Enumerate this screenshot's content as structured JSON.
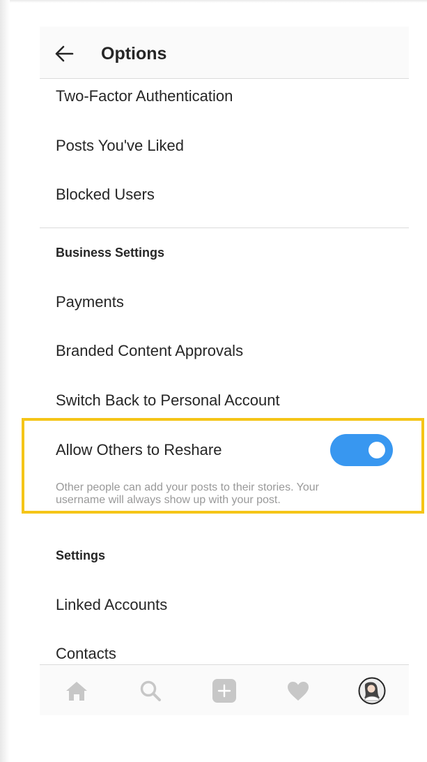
{
  "header": {
    "title": "Options",
    "back_icon": "arrow-left-icon"
  },
  "account_items": [
    {
      "label": "Two-Factor Authentication"
    },
    {
      "label": "Posts You've Liked"
    },
    {
      "label": "Blocked Users"
    }
  ],
  "business": {
    "section_title": "Business Settings",
    "items": [
      {
        "label": "Payments"
      },
      {
        "label": "Branded Content Approvals"
      },
      {
        "label": "Switch Back to Personal Account"
      }
    ],
    "reshare": {
      "label": "Allow Others to Reshare",
      "enabled": true,
      "description": "Other people can add your posts to their stories. Your username will always show up with your post."
    }
  },
  "settings": {
    "section_title": "Settings",
    "items": [
      {
        "label": "Linked Accounts"
      },
      {
        "label": "Contacts"
      }
    ]
  },
  "tabbar": {
    "tabs": [
      {
        "icon": "home-icon"
      },
      {
        "icon": "search-icon"
      },
      {
        "icon": "add-post-icon"
      },
      {
        "icon": "heart-icon"
      },
      {
        "icon": "profile-avatar-icon"
      }
    ]
  },
  "colors": {
    "toggle_on": "#3897f0",
    "highlight": "#f5c518",
    "tab_icon": "#c7c7c7",
    "text": "#262626",
    "muted": "#999999"
  }
}
